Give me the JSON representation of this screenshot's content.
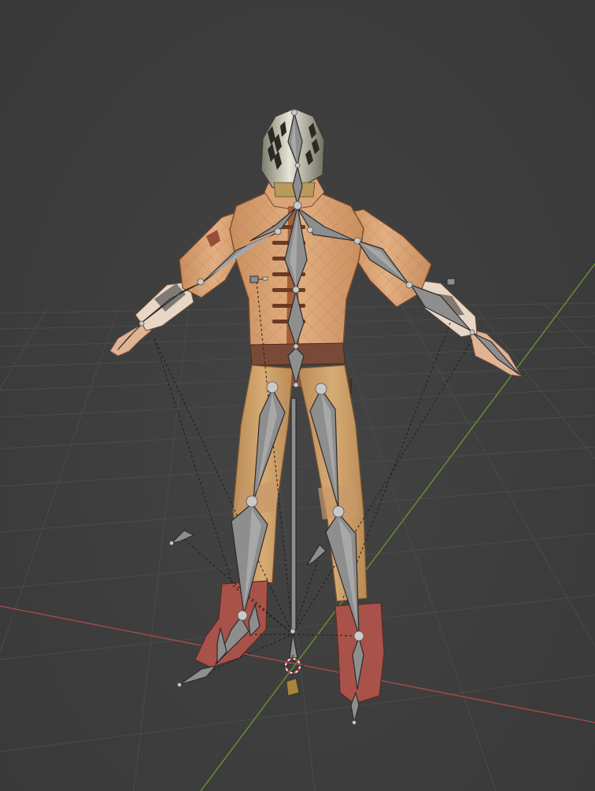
{
  "viewport": {
    "mode": "3d-viewport",
    "background_color": "#3d3d3d",
    "grid_color": "#4b4b4b",
    "x_axis_color": "#b04a4a",
    "y_axis_color": "#6a9a2c",
    "scene_object": "character-armature",
    "cursor_icon": "3d-cursor-icon"
  }
}
